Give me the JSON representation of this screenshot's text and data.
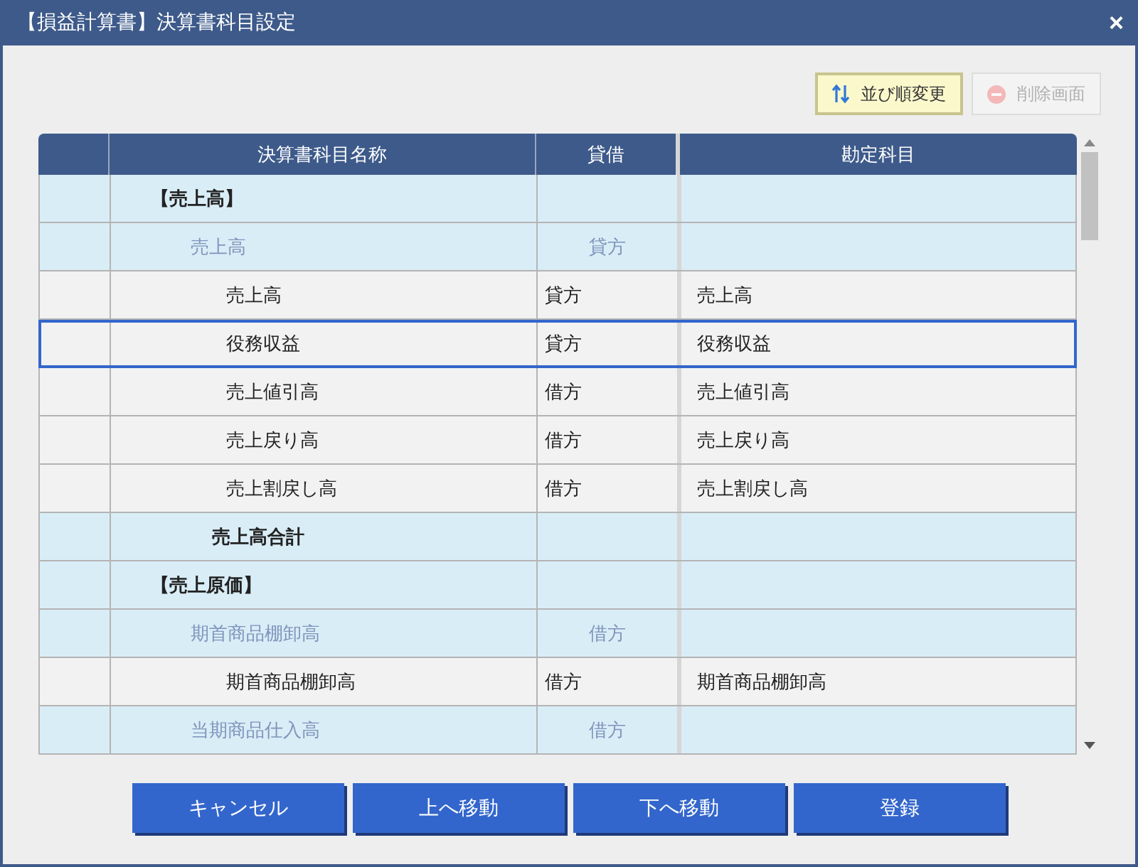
{
  "window": {
    "title": "【損益計算書】決算書科目設定",
    "close": "×"
  },
  "toolbar": [
    {
      "kind": "sort",
      "label": "並び順変更",
      "disabled": false
    },
    {
      "kind": "delete",
      "label": "削除画面",
      "disabled": true
    }
  ],
  "table": {
    "columns": [
      "決算書科目名称",
      "貸借",
      "勘定科目"
    ],
    "rows": [
      {
        "kind": "heading",
        "name": "【売上高】",
        "selected": false
      },
      {
        "kind": "group",
        "name": "売上高",
        "side": "貸方",
        "selected": false
      },
      {
        "kind": "item",
        "name": "売上高",
        "side": "貸方",
        "account": "売上高",
        "selected": false
      },
      {
        "kind": "item",
        "name": "役務収益",
        "side": "貸方",
        "account": "役務収益",
        "selected": true
      },
      {
        "kind": "item",
        "name": "売上値引高",
        "side": "借方",
        "account": "売上値引高",
        "selected": false
      },
      {
        "kind": "item",
        "name": "売上戻り高",
        "side": "借方",
        "account": "売上戻り高",
        "selected": false
      },
      {
        "kind": "item",
        "name": "売上割戻し高",
        "side": "借方",
        "account": "売上割戻し高",
        "selected": false
      },
      {
        "kind": "total",
        "name": "売上高合計",
        "selected": false
      },
      {
        "kind": "heading",
        "name": "【売上原価】",
        "selected": false
      },
      {
        "kind": "group",
        "name": "期首商品棚卸高",
        "side": "借方",
        "selected": false
      },
      {
        "kind": "item",
        "name": "期首商品棚卸高",
        "side": "借方",
        "account": "期首商品棚卸高",
        "selected": false
      },
      {
        "kind": "group",
        "name": "当期商品仕入高",
        "side": "借方",
        "selected": false
      }
    ]
  },
  "buttons": [
    "キャンセル",
    "上へ移動",
    "下へ移動",
    "登録"
  ]
}
